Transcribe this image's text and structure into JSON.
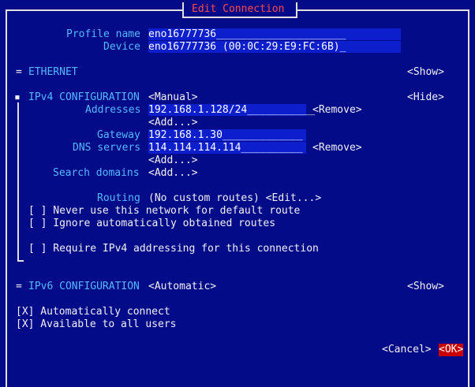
{
  "dialog": {
    "title": "Edit Connection"
  },
  "profile": {
    "name_label": "Profile name",
    "name_value": "eno16777736_____________________",
    "device_label": "Device",
    "device_value": "eno16777736 (00:0C:29:E9:FC:6B)_"
  },
  "ethernet": {
    "marker": "=",
    "label": "ETHERNET",
    "show": "<Show>"
  },
  "ipv4": {
    "marker": "▪",
    "label": "IPv4 CONFIGURATION",
    "method": "<Manual>",
    "hide": "<Hide>",
    "addresses_label": "Addresses",
    "address_value": "192.168.1.128/24___________",
    "remove1": "<Remove>",
    "add1": "<Add...>",
    "gateway_label": "Gateway",
    "gateway_value": "192.168.1.30_____________",
    "dns_label": "DNS servers",
    "dns_value": "114.114.114.114__________",
    "remove2": "<Remove>",
    "add2": "<Add...>",
    "search_label": "Search domains",
    "add3": "<Add...>",
    "routing_label": "Routing",
    "routing_value": "(No custom routes) <Edit...>",
    "never_default": "[ ] Never use this network for default route",
    "ignore_routes": "[ ] Ignore automatically obtained routes",
    "require_ipv4": "[ ] Require IPv4 addressing for this connection"
  },
  "ipv6": {
    "marker": "=",
    "label": "IPv6 CONFIGURATION",
    "method": "<Automatic>",
    "show": "<Show>"
  },
  "options": {
    "auto_connect": "[X] Automatically connect",
    "all_users": "[X] Available to all users"
  },
  "buttons": {
    "cancel": "<Cancel>",
    "ok": "<OK>"
  }
}
